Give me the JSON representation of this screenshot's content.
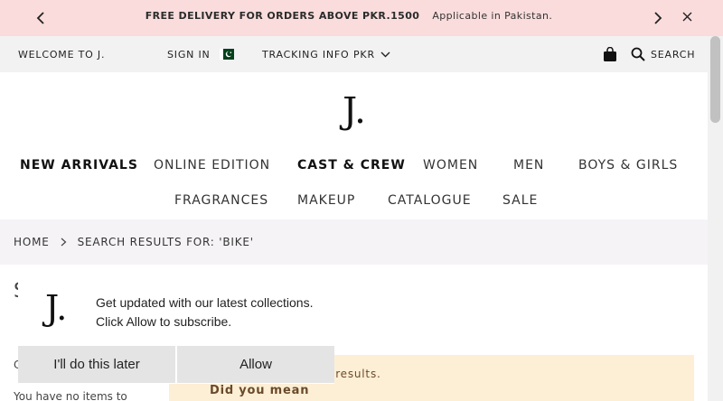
{
  "promo": {
    "headline": "FREE DELIVERY FOR ORDERS ABOVE PKR.1500",
    "subtext": "Applicable in Pakistan."
  },
  "utility": {
    "welcome": "WELCOME TO J.",
    "sign_in": "SIGN IN",
    "tracking": "TRACKING INFO",
    "currency": "PKR",
    "search": "SEARCH"
  },
  "brand": {
    "logo": "J."
  },
  "nav": {
    "row1": [
      "NEW ARRIVALS",
      "ONLINE EDITION",
      "CAST & CREW",
      "WOMEN",
      "MEN",
      "BOYS & GIRLS"
    ],
    "row2": [
      "FRAGRANCES",
      "MAKEUP",
      "CATALOGUE",
      "SALE"
    ]
  },
  "breadcrumb": {
    "home": "HOME",
    "current": "SEARCH RESULTS FOR: 'BIKE'"
  },
  "content": {
    "heading_partial": "S",
    "side_partial": "C",
    "side_empty": "You have no items to",
    "notice_text": "d no results.",
    "did_you_mean": "Did you mean"
  },
  "push": {
    "logo": "J.",
    "line1": "Get updated with our latest collections.",
    "line2": "Click Allow to subscribe.",
    "later": "I'll do this later",
    "allow": "Allow"
  },
  "colors": {
    "promo_bg": "#fadcdc",
    "util_bg": "#f2f2f2",
    "crumb_bg": "#f6f3f7",
    "notice_bg": "#fdefd5",
    "flag_green": "#01411c"
  },
  "icons": [
    "chevron-left-icon",
    "chevron-right-icon",
    "close-icon",
    "pakistan-flag-icon",
    "chevron-down-icon",
    "shopping-bag-icon",
    "search-icon",
    "breadcrumb-chevron-icon"
  ]
}
